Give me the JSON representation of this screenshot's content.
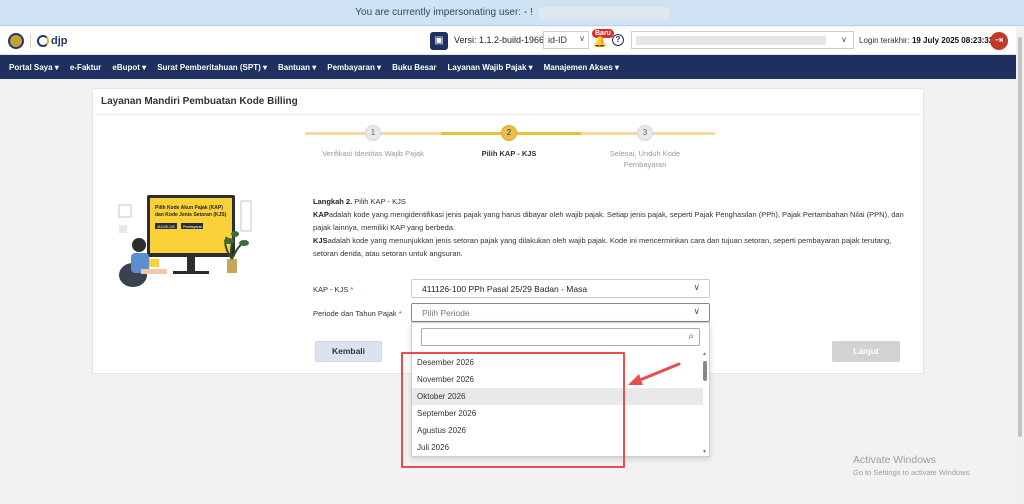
{
  "impersonation": {
    "text": "You are currently impersonating user: - !"
  },
  "header": {
    "logo_text": "djp",
    "version_label": "Versi:  1.1.2-build-1966",
    "language": "id-ID",
    "badge_new": "Baru",
    "login_label": "Login terakhir:",
    "login_value": "19 July 2025 08:23:32"
  },
  "nav": {
    "items": [
      {
        "label": "Portal Saya ▾"
      },
      {
        "label": "e-Faktur"
      },
      {
        "label": "eBupot ▾"
      },
      {
        "label": "Surat Pemberitahuan (SPT) ▾"
      },
      {
        "label": "Bantuan ▾"
      },
      {
        "label": "Pembayaran ▾"
      },
      {
        "label": "Buku Besar"
      },
      {
        "label": "Layanan Wajib Pajak ▾"
      },
      {
        "label": "Manajemen Akses ▾"
      }
    ]
  },
  "card": {
    "title": "Layanan Mandiri Pembuatan Kode Billing"
  },
  "stepper": {
    "steps": [
      {
        "num": "1",
        "label": "Verifikasi Identitas Wajib Pajak"
      },
      {
        "num": "2",
        "label": "Pilih KAP - KJS"
      },
      {
        "num": "3",
        "label": "Selesai, Unduh Kode Pembayaran"
      }
    ]
  },
  "content": {
    "langkah_bold": "Langkah 2.",
    "langkah_text": " Pilih KAP - KJS",
    "kap_term": "KAP",
    "kap_desc": "adalah kode yang mengidentifikasi jenis pajak yang harus dibayar oleh wajib pajak. Setiap jenis pajak, seperti Pajak Penghasilan (PPh), Pajak Pertambahan Nilai (PPN), dan pajak lainnya, memiliki KAP yang berbeda.",
    "kjs_term": "KJS",
    "kjs_desc": "adalah kode yang menunjukkan jenis setoran pajak yang dilakukan oleh wajib pajak. Kode ini mencerminkan cara dan tujuan setoran, seperti pembayaran pajak terutang, setoran denda, atau setoran untuk angsuran."
  },
  "form": {
    "kap_label": "KAP - KJS",
    "kap_value": "411126-100 PPh Pasal 25/29 Badan - Masa",
    "periode_label": "Periode dan Tahun Pajak",
    "periode_placeholder": "Pilih Periode",
    "required_mark": "*"
  },
  "illustration": {
    "line1": "Pilih Kode Akun Pajak (KAP)",
    "line2": "dan Kode Jenis Setoran (KJS)",
    "tag1": "411125-100",
    "tag2": "Pembayaran"
  },
  "buttons": {
    "back": "Kembali",
    "next": "Lanjut"
  },
  "dropdown": {
    "options": [
      "Desember 2026",
      "November 2026",
      "Oktober 2026",
      "September 2026",
      "Agustus 2026",
      "Juli 2026"
    ],
    "highlighted": "Oktober 2026"
  },
  "watermark": {
    "title": "Activate Windows",
    "subtitle": "Go to Settings to activate Windows."
  },
  "colors": {
    "navbar": "#1f2f5f",
    "accent": "#e9bf3c",
    "annotation": "#e84e4e"
  }
}
